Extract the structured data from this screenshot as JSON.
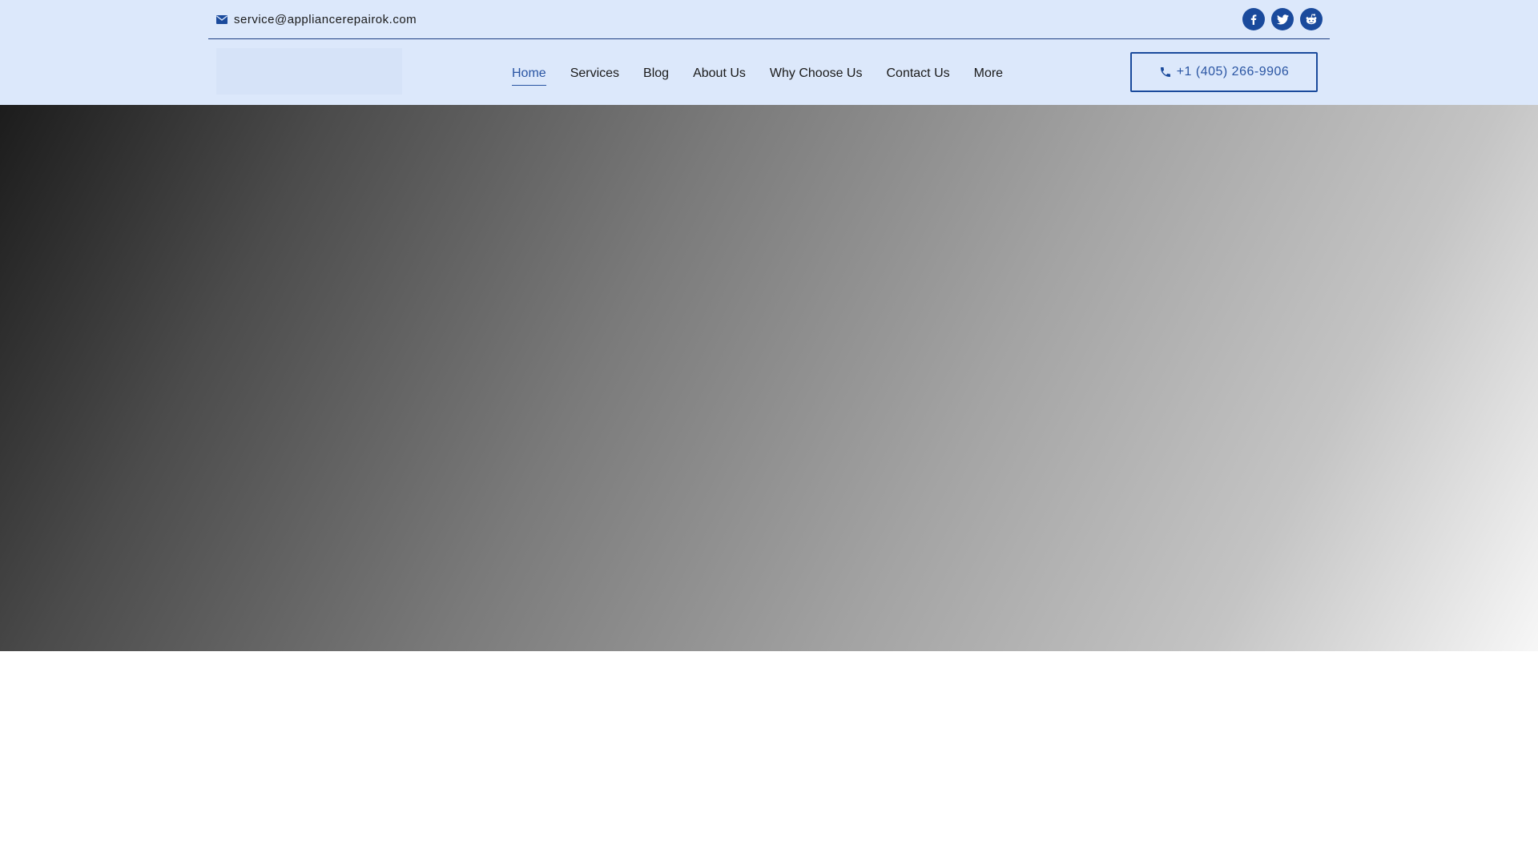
{
  "topbar": {
    "email": "service@appliancerepairok.com",
    "email_icon": "envelope-icon",
    "socials": [
      {
        "name": "facebook",
        "icon": "facebook-icon"
      },
      {
        "name": "twitter",
        "icon": "twitter-icon"
      },
      {
        "name": "reddit",
        "icon": "reddit-icon"
      }
    ]
  },
  "nav": {
    "items": [
      {
        "label": "Home",
        "active": true
      },
      {
        "label": "Services"
      },
      {
        "label": "Blog"
      },
      {
        "label": "About Us"
      },
      {
        "label": "Why Choose Us"
      },
      {
        "label": "Contact Us"
      },
      {
        "label": "More"
      }
    ]
  },
  "cta": {
    "phone": "+1 (405) 266-9906",
    "icon": "phone-icon"
  },
  "colors": {
    "header_bg": "#dce8fb",
    "accent": "#1a4a9c",
    "accent_text": "#2a55a3"
  }
}
